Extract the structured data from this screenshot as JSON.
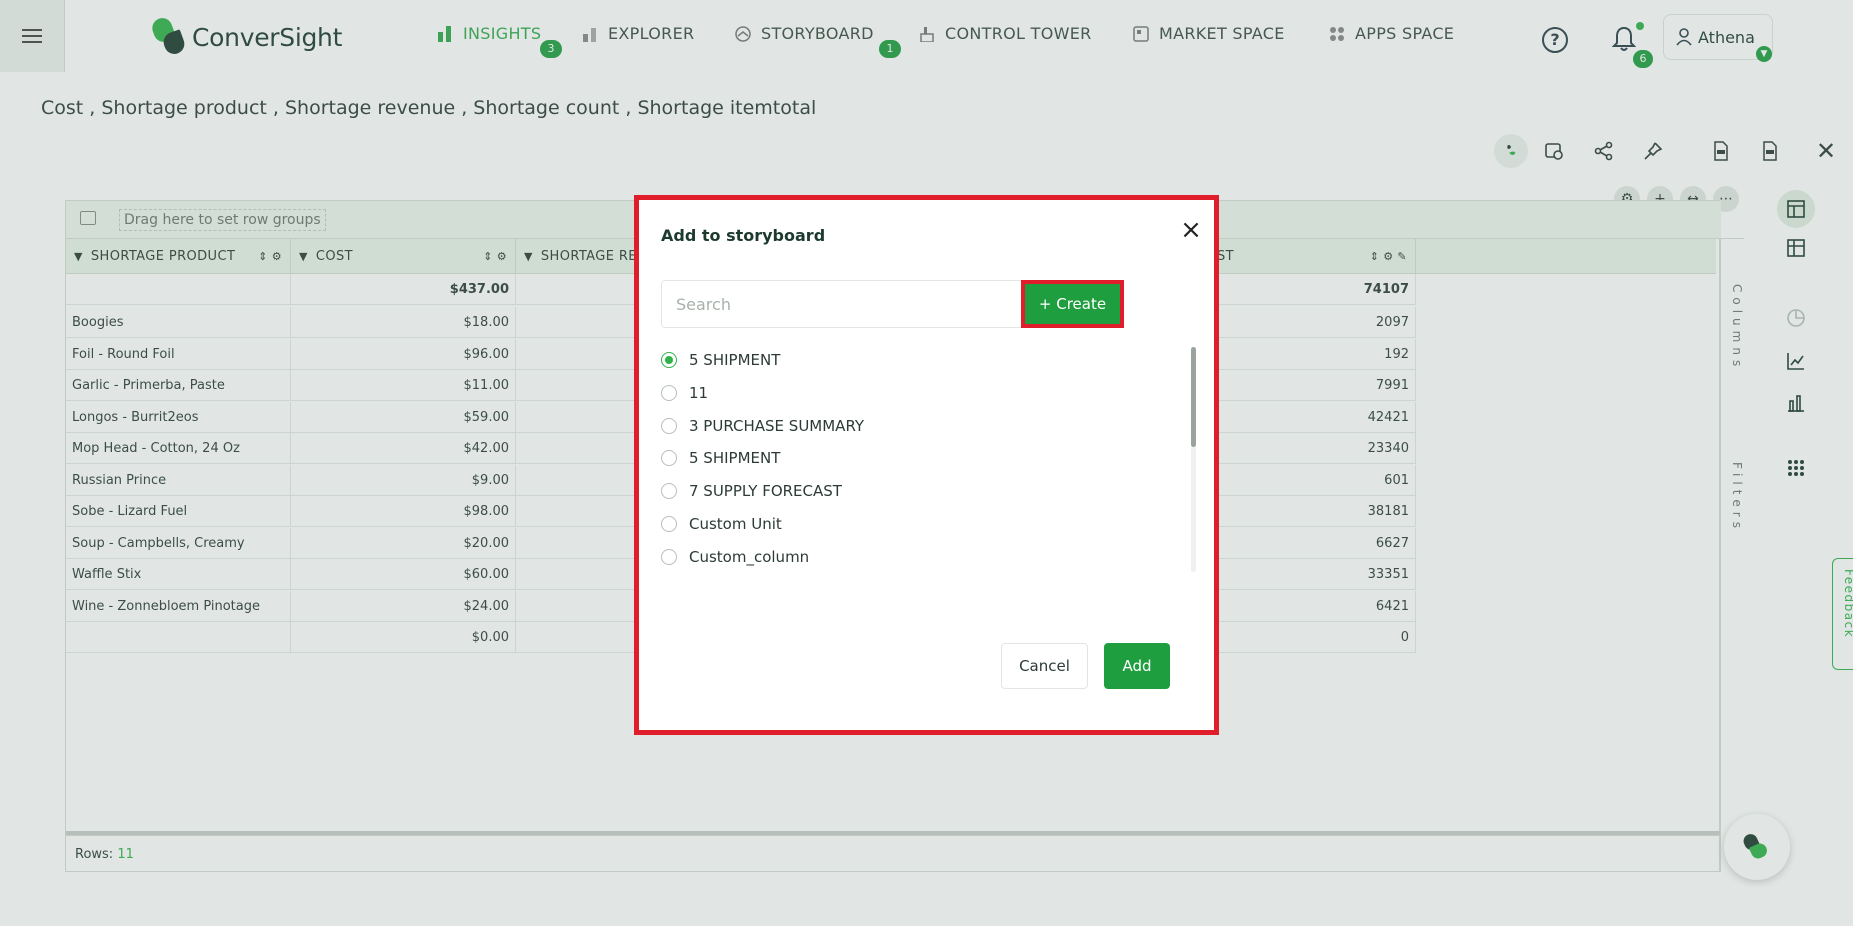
{
  "app": {
    "logo_text": "ConverSight",
    "brand_color": "#2fb34a",
    "dark_color": "#1d3a2f"
  },
  "nav": {
    "items": [
      {
        "label": "INSIGHTS",
        "icon": "bar-chart-icon",
        "badge": "3",
        "active": true
      },
      {
        "label": "EXPLORER",
        "icon": "explorer-icon",
        "badge": "",
        "active": false
      },
      {
        "label": "STORYBOARD",
        "icon": "storyboard-icon",
        "badge": "1",
        "active": false
      },
      {
        "label": "CONTROL TOWER",
        "icon": "control-tower-icon",
        "badge": "",
        "active": false
      },
      {
        "label": "MARKET SPACE",
        "icon": "market-space-icon",
        "badge": "",
        "active": false
      },
      {
        "label": "APPS SPACE",
        "icon": "apps-space-icon",
        "badge": "",
        "active": false
      }
    ]
  },
  "header": {
    "notification_count": "6",
    "user_name": "Athena"
  },
  "page": {
    "title": "Cost , Shortage product , Shortage revenue , Shortage count , Shortage itemtotal"
  },
  "grid": {
    "row_group_hint": "Drag here to set row groups",
    "columns": [
      "SHORTAGE PRODUCT",
      "COST",
      "SHORTAGE RE",
      "TEST"
    ],
    "total_row": {
      "cost": "$437.00",
      "last": "74107"
    },
    "rows": [
      {
        "product": "Boogies",
        "cost": "$18.00",
        "last": "2097"
      },
      {
        "product": "Foil - Round Foil",
        "cost": "$96.00",
        "last": "192"
      },
      {
        "product": "Garlic - Primerba, Paste",
        "cost": "$11.00",
        "last": "7991"
      },
      {
        "product": "Longos - Burrit2eos",
        "cost": "$59.00",
        "last": "42421"
      },
      {
        "product": "Mop Head - Cotton, 24 Oz",
        "cost": "$42.00",
        "last": "23340"
      },
      {
        "product": "Russian Prince",
        "cost": "$9.00",
        "last": "601"
      },
      {
        "product": "Sobe - Lizard Fuel",
        "cost": "$98.00",
        "last": "38181"
      },
      {
        "product": "Soup - Campbells, Creamy",
        "cost": "$20.00",
        "last": "6627"
      },
      {
        "product": "Waffle Stix",
        "cost": "$60.00",
        "last": "33351"
      },
      {
        "product": "Wine - Zonnebloem Pinotage",
        "cost": "$24.00",
        "last": "6421"
      },
      {
        "product": "",
        "cost": "$0.00",
        "last": "0"
      }
    ],
    "footer_label": "Rows:",
    "footer_count": "11",
    "side_columns": "Columns",
    "side_filters": "Filters"
  },
  "feedback_label": "Feedback",
  "modal": {
    "title": "Add to storyboard",
    "search_placeholder": "Search",
    "create_label": "+ Create",
    "options": [
      {
        "label": "5 SHIPMENT",
        "checked": true
      },
      {
        "label": "11",
        "checked": false
      },
      {
        "label": "3 PURCHASE SUMMARY",
        "checked": false
      },
      {
        "label": "5 SHIPMENT",
        "checked": false
      },
      {
        "label": "7 SUPPLY FORECAST",
        "checked": false
      },
      {
        "label": "Custom Unit",
        "checked": false
      },
      {
        "label": "Custom_column",
        "checked": false
      }
    ],
    "cancel_label": "Cancel",
    "add_label": "Add"
  }
}
